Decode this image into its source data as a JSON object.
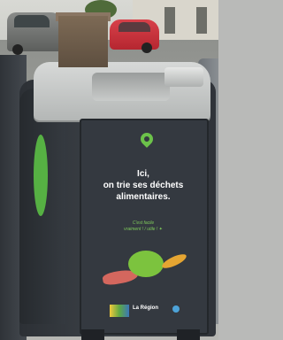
{
  "photo": {
    "bin_message": [
      "Ici,",
      "on trie ses déchets",
      "alimentaires."
    ],
    "tagline": "C'est facile\nvraiment ! / utile ! ✦",
    "logo_text": "La Région",
    "colors": {
      "accent_green": "#6cc24a",
      "panel": "#343940",
      "lid": "#c8cbca"
    }
  }
}
